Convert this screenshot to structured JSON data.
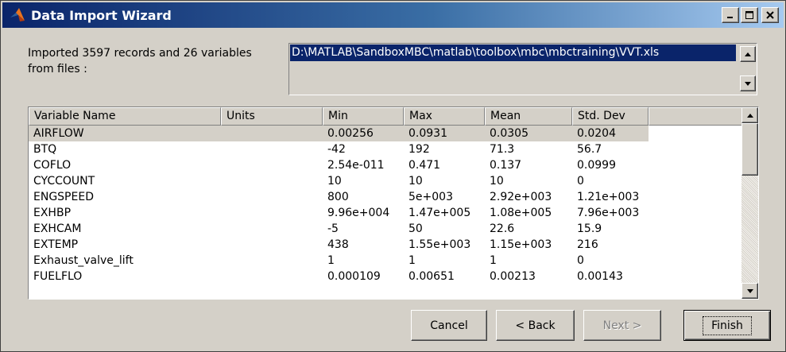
{
  "window": {
    "title": "Data Import Wizard",
    "controls": {
      "minimize": "_",
      "maximize": "□",
      "close": "×"
    }
  },
  "summary": {
    "line1": "Imported 3597 records and 26 variables",
    "line2": "from files :"
  },
  "files": {
    "items": [
      "D:\\MATLAB\\SandboxMBC\\matlab\\toolbox\\mbc\\mbctraining\\VVT.xls"
    ],
    "selected_index": 0
  },
  "table": {
    "columns": [
      "Variable Name",
      "Units",
      "Min",
      "Max",
      "Mean",
      "Std. Dev"
    ],
    "rows": [
      [
        "AIRFLOW",
        "",
        "0.00256",
        "0.0931",
        "0.0305",
        "0.0204"
      ],
      [
        "BTQ",
        "",
        "-42",
        "192",
        "71.3",
        "56.7"
      ],
      [
        "COFLO",
        "",
        "2.54e-011",
        "0.471",
        "0.137",
        "0.0999"
      ],
      [
        "CYCCOUNT",
        "",
        "10",
        "10",
        "10",
        "0"
      ],
      [
        "ENGSPEED",
        "",
        "800",
        "5e+003",
        "2.92e+003",
        "1.21e+003"
      ],
      [
        "EXHBP",
        "",
        "9.96e+004",
        "1.47e+005",
        "1.08e+005",
        "7.96e+003"
      ],
      [
        "EXHCAM",
        "",
        "-5",
        "50",
        "22.6",
        "15.9"
      ],
      [
        "EXTEMP",
        "",
        "438",
        "1.55e+003",
        "1.15e+003",
        "216"
      ],
      [
        "Exhaust_valve_lift",
        "",
        "1",
        "1",
        "1",
        "0"
      ],
      [
        "FUELFLO",
        "",
        "0.000109",
        "0.00651",
        "0.00213",
        "0.00143"
      ]
    ],
    "selected_row": 0
  },
  "buttons": {
    "cancel": "Cancel",
    "back": "< Back",
    "next": "Next >",
    "finish": "Finish"
  },
  "colors": {
    "face": "#d4d0c8",
    "selection": "#0a246a",
    "title_start": "#0a246a",
    "title_end": "#a6caf0"
  },
  "icons": {
    "app": "matlab-icon",
    "up": "arrow-up-icon",
    "down": "arrow-down-icon"
  }
}
